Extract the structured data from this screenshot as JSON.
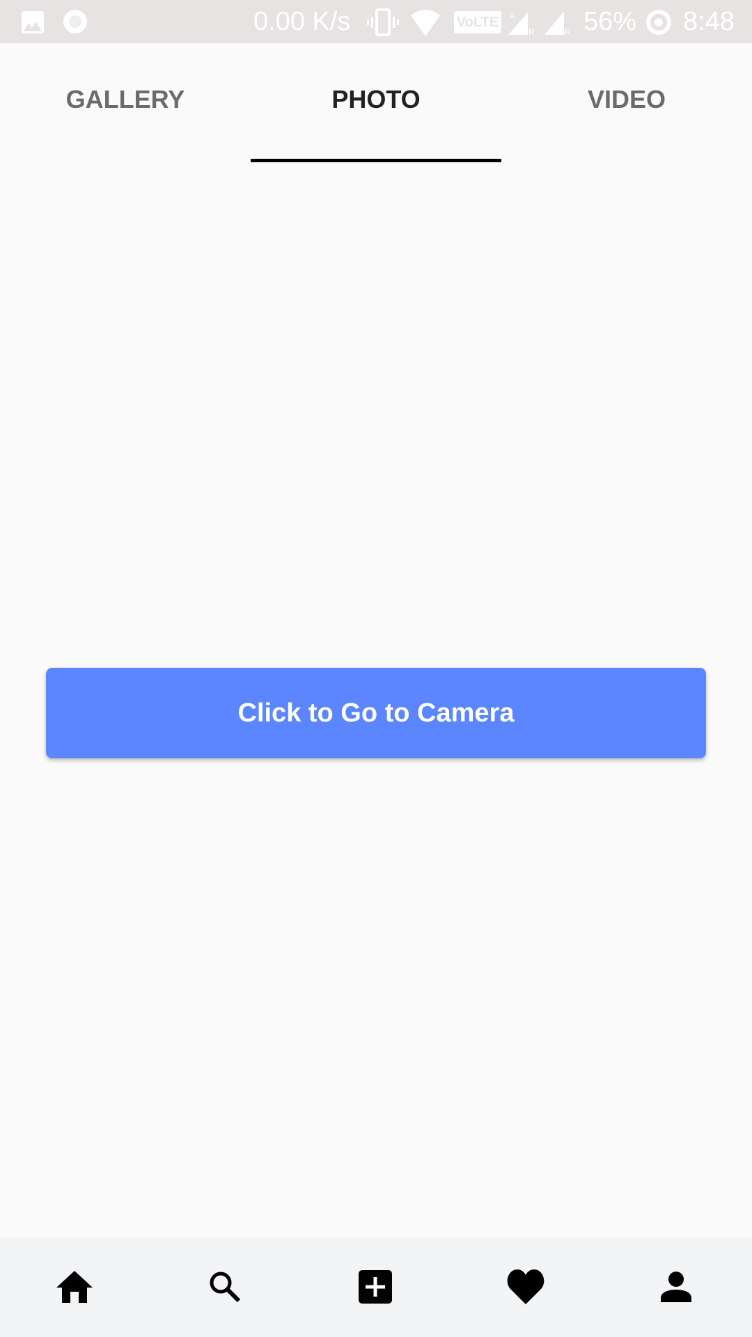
{
  "status_bar": {
    "speed": "0.00 K/s",
    "battery": "56%",
    "time": "8:48",
    "volte": "VoLTE",
    "icons": [
      "gallery-notification-icon",
      "circle-notification-icon",
      "vibrate-icon",
      "wifi-icon",
      "volte-icon",
      "signal-icon",
      "signal-icon",
      "battery-saver-icon"
    ]
  },
  "tabs": [
    {
      "label": "GALLERY"
    },
    {
      "label": "PHOTO",
      "active": true
    },
    {
      "label": "VIDEO"
    }
  ],
  "main": {
    "camera_button": "Click to Go to Camera",
    "accent": "#5c86ff"
  },
  "bottom_nav": [
    "home-icon",
    "search-icon",
    "add-icon",
    "heart-icon",
    "profile-icon"
  ]
}
